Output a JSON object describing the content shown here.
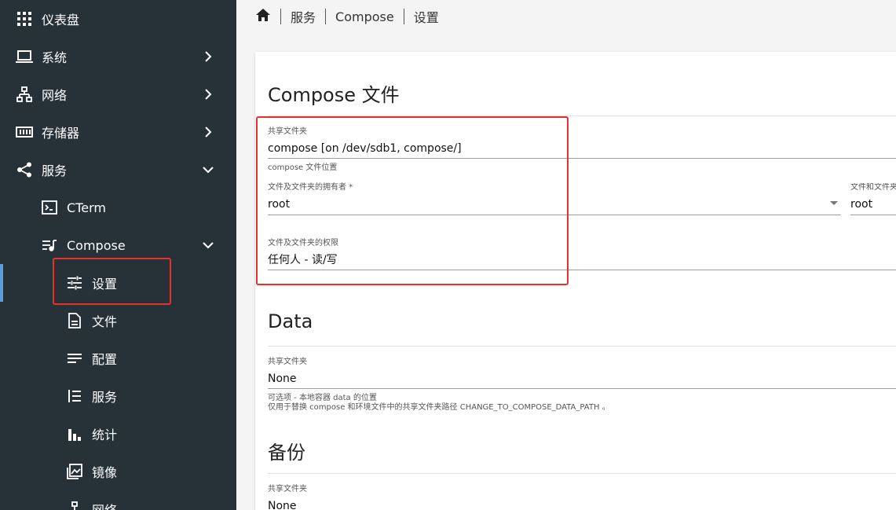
{
  "sidebar": {
    "items": [
      {
        "label": "仪表盘",
        "icon": "apps-grid-icon"
      },
      {
        "label": "系统",
        "icon": "laptop-icon"
      },
      {
        "label": "网络",
        "icon": "network-icon"
      },
      {
        "label": "存储器",
        "icon": "storage-icon"
      },
      {
        "label": "服务",
        "icon": "share-icon"
      },
      {
        "label": "CTerm",
        "icon": "terminal-icon"
      },
      {
        "label": "Compose",
        "icon": "playlist-music-icon"
      },
      {
        "label": "设置",
        "icon": "tune-icon"
      },
      {
        "label": "文件",
        "icon": "file-document-icon"
      },
      {
        "label": "配置",
        "icon": "text-lines-icon"
      },
      {
        "label": "服务",
        "icon": "format-list-icon"
      },
      {
        "label": "统计",
        "icon": "bar-chart-icon"
      },
      {
        "label": "镜像",
        "icon": "image-icon"
      },
      {
        "label": "网络",
        "icon": "network-icon"
      }
    ]
  },
  "breadcrumb": {
    "items": [
      "服务",
      "Compose",
      "设置"
    ]
  },
  "compose_section": {
    "title": "Compose 文件",
    "shared_folder": {
      "label": "共享文件夹",
      "value": "compose [on /dev/sdb1, compose/]",
      "hint": "compose 文件位置"
    },
    "owner": {
      "label": "文件及文件夹的拥有者 *",
      "value": "root"
    },
    "group": {
      "label": "文件和文件夹",
      "value": "root"
    },
    "permissions": {
      "label": "文件及文件夹的权限",
      "value": "任何人 - 读/写"
    }
  },
  "data_section": {
    "title": "Data",
    "shared_folder": {
      "label": "共享文件夹",
      "value": "None"
    },
    "hint_line1": "可选项 - 本地容器 data 的位置",
    "hint_line2": "仅用于替换 compose 和环境文件中的共享文件夹路径 CHANGE_TO_COMPOSE_DATA_PATH 。"
  },
  "backup_section": {
    "title": "备份",
    "shared_folder": {
      "label": "共享文件夹",
      "value": "None"
    }
  },
  "colors": {
    "sidebar_bg": "#263238",
    "active_indicator": "#5c9fd6",
    "highlight_red": "#e5322d"
  }
}
